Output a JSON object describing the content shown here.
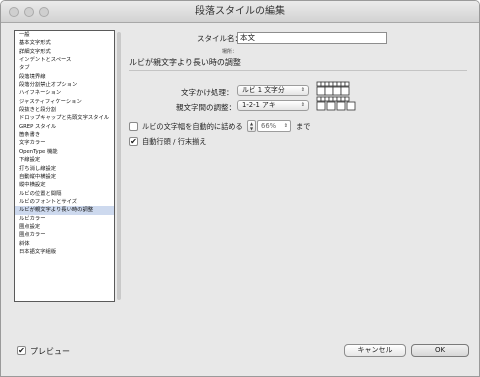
{
  "window": {
    "title": "段落スタイルの編集"
  },
  "categories": [
    "一般",
    "基本文字形式",
    "詳細文字形式",
    "インデントとスペース",
    "タブ",
    "段落境界線",
    "段落分割禁止オプション",
    "ハイフネーション",
    "ジャスティフィケーション",
    "段抜きと段分割",
    "ドロップキャップと先頭文字スタイル",
    "GREP スタイル",
    "箇条書き",
    "文字カラー",
    "OpenType 機能",
    "下線設定",
    "打ち消し線設定",
    "自動縦中横設定",
    "縦中横設定",
    "ルビの位置と間隔",
    "ルビのフォントとサイズ",
    "ルビが親文字より長い時の調整",
    "ルビカラー",
    "圏点設定",
    "圏点カラー",
    "斜体",
    "日本語文字組版"
  ],
  "selected_category": "ルビが親文字より長い時の調整",
  "style_name": {
    "label": "スタイル名：",
    "value": "本文"
  },
  "location_label": "場所：",
  "section_title": "ルビが親文字より長い時の調整",
  "overhang": {
    "label": "文字かけ処理：",
    "value": "ルビ 1 文字分"
  },
  "spacing": {
    "label": "親文字間の調整：",
    "value": "1-2-1 アキ"
  },
  "compress": {
    "label": "ルビの文字幅を自動的に詰める",
    "value": "66%",
    "suffix": "まで",
    "checked": false
  },
  "autowrap": {
    "label": "自動行頭 / 行末揃え",
    "checked": true
  },
  "preview": {
    "label": "プレビュー",
    "checked": true
  },
  "buttons": {
    "cancel": "キャンセル",
    "ok": "OK"
  }
}
